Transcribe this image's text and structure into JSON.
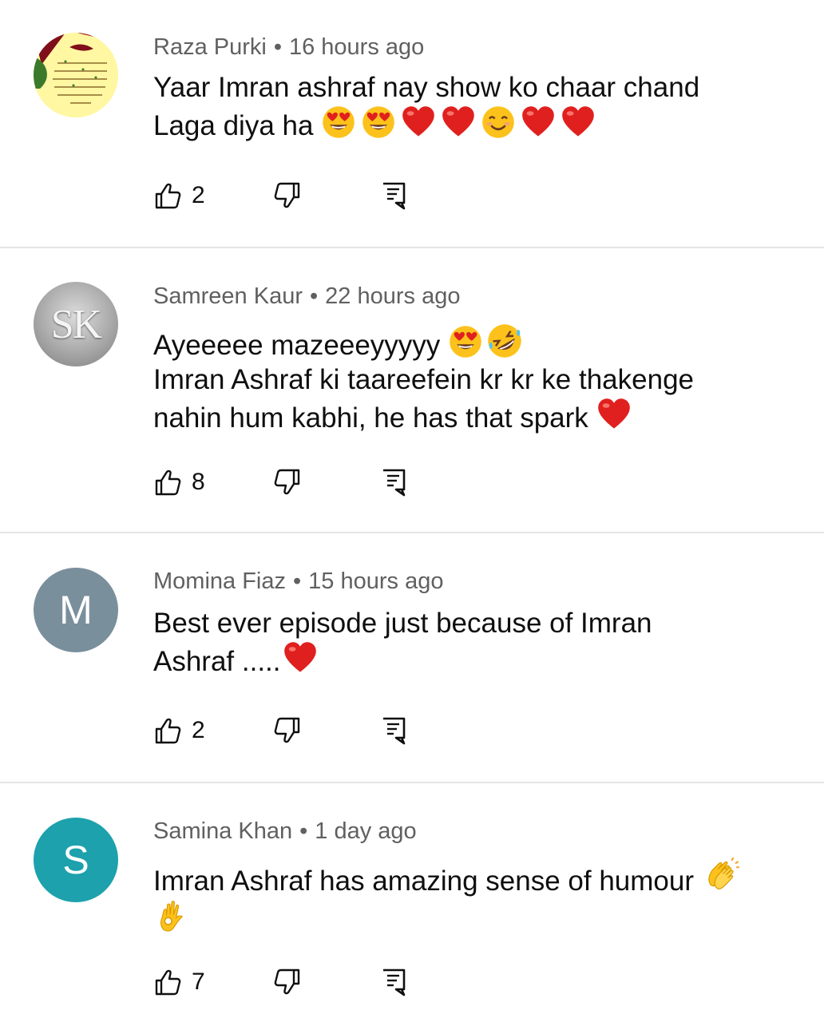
{
  "colors": {
    "meta_text": "#606060",
    "body_text": "#0f0f0f",
    "divider": "#e5e5e5",
    "avatar_m": "#7a8f9c",
    "avatar_s": "#1ca1ad",
    "heart": "#e0201e",
    "emoji_yellow": "#fcc21b"
  },
  "comments": [
    {
      "author": "Raza Purki",
      "time": "16 hours ago",
      "avatar": {
        "type": "image",
        "description_icon": "urdu-greeting-card-avatar"
      },
      "lines": [
        "Yaar Imran ashraf nay show ko chaar chand",
        "Laga diya ha"
      ],
      "emojis": [
        "heart-eyes",
        "heart-eyes",
        "red-heart",
        "red-heart",
        "smiling-face",
        "red-heart",
        "red-heart"
      ],
      "likes": "2"
    },
    {
      "author": "Samreen Kaur",
      "time": "22 hours ago",
      "avatar": {
        "type": "image",
        "letters": "SK"
      },
      "lines": [
        "Ayeeeee mazeeeyyyyy",
        "Imran Ashraf ki taareefein kr kr ke thakenge",
        "nahin hum kabhi, he has that spark"
      ],
      "emojis": [
        "heart-eyes",
        "rolling-laughing",
        "red-heart"
      ],
      "likes": "8"
    },
    {
      "author": "Momina Fiaz",
      "time": "15 hours ago",
      "avatar": {
        "type": "letter",
        "letter": "M"
      },
      "lines": [
        "Best ever episode just because of Imran",
        "Ashraf ....."
      ],
      "emojis": [
        "red-heart"
      ],
      "likes": "2"
    },
    {
      "author": "Samina Khan",
      "time": "1 day ago",
      "avatar": {
        "type": "letter",
        "letter": "S"
      },
      "lines": [
        "Imran Ashraf has amazing sense of humour"
      ],
      "emojis": [
        "clapping-hands",
        "ok-hand"
      ],
      "likes": "7"
    }
  ],
  "icons": {
    "like": "thumbs-up-icon",
    "dislike": "thumbs-down-icon",
    "reply": "reply-icon"
  }
}
